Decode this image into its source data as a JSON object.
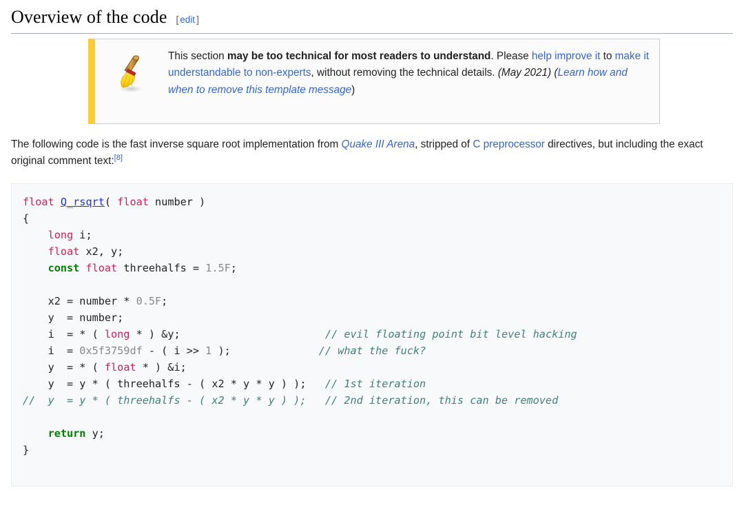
{
  "heading": {
    "title": "Overview of the code",
    "edit_open_bracket": "[",
    "edit_label": "edit",
    "edit_close_bracket": "]"
  },
  "notice": {
    "icon": "broom-icon",
    "accent_color": "#ffcc33",
    "border_color": "#c8ccd1",
    "background": "#fbfbfb",
    "text_parts": {
      "p1": "This section ",
      "bold1": "may be too technical for most readers to understand",
      "p2": ". Please ",
      "link1": "help improve it",
      "p3": " to ",
      "link2": "make it understandable to non-experts",
      "p4": ", without removing the technical details. ",
      "date": "(May 2021)",
      "p5": " (",
      "link3": "Learn how and when to remove this template message",
      "p6": ")"
    }
  },
  "intro": {
    "p1": "The following code is the fast inverse square root implementation from ",
    "link_quake": "Quake III Arena",
    "p2": ", stripped of ",
    "link_cpp": "C preprocessor",
    "p3": " directives, but including the exact original comment text:",
    "reference": "[8]"
  },
  "code": {
    "language": "C",
    "background": "#f8f9fa",
    "colors": {
      "type": "#cc2255",
      "keyword": "#008000",
      "function": "#2233cc",
      "number": "#888888",
      "comment": "#3f7f7f",
      "plain": "#222222"
    },
    "lines": [
      {
        "tokens": [
          {
            "t": "float",
            "c": "type"
          },
          {
            "t": " ",
            "c": "plain"
          },
          {
            "t": "Q_rsqrt",
            "c": "function"
          },
          {
            "t": "( ",
            "c": "plain"
          },
          {
            "t": "float",
            "c": "type"
          },
          {
            "t": " number )",
            "c": "plain"
          }
        ]
      },
      {
        "tokens": [
          {
            "t": "{",
            "c": "plain"
          }
        ]
      },
      {
        "tokens": [
          {
            "t": "    ",
            "c": "plain"
          },
          {
            "t": "long",
            "c": "type"
          },
          {
            "t": " i;",
            "c": "plain"
          }
        ]
      },
      {
        "tokens": [
          {
            "t": "    ",
            "c": "plain"
          },
          {
            "t": "float",
            "c": "type"
          },
          {
            "t": " x2, y;",
            "c": "plain"
          }
        ]
      },
      {
        "tokens": [
          {
            "t": "    ",
            "c": "plain"
          },
          {
            "t": "const",
            "c": "keyword"
          },
          {
            "t": " ",
            "c": "plain"
          },
          {
            "t": "float",
            "c": "type"
          },
          {
            "t": " threehalfs = ",
            "c": "plain"
          },
          {
            "t": "1.5F",
            "c": "number"
          },
          {
            "t": ";",
            "c": "plain"
          }
        ]
      },
      {
        "tokens": [
          {
            "t": "",
            "c": "plain"
          }
        ]
      },
      {
        "tokens": [
          {
            "t": "    x2 = number * ",
            "c": "plain"
          },
          {
            "t": "0.5F",
            "c": "number"
          },
          {
            "t": ";",
            "c": "plain"
          }
        ]
      },
      {
        "tokens": [
          {
            "t": "    y  = number;",
            "c": "plain"
          }
        ]
      },
      {
        "tokens": [
          {
            "t": "    i  = * ( ",
            "c": "plain"
          },
          {
            "t": "long",
            "c": "type"
          },
          {
            "t": " * ) &y;",
            "c": "plain"
          },
          {
            "t": "                       ",
            "c": "plain"
          },
          {
            "t": "// evil floating point bit level hacking",
            "c": "comment"
          }
        ]
      },
      {
        "tokens": [
          {
            "t": "    i  = ",
            "c": "plain"
          },
          {
            "t": "0x5f3759df",
            "c": "number"
          },
          {
            "t": " - ( i >> ",
            "c": "plain"
          },
          {
            "t": "1",
            "c": "number"
          },
          {
            "t": " );",
            "c": "plain"
          },
          {
            "t": "              ",
            "c": "plain"
          },
          {
            "t": "// what the fuck?",
            "c": "comment"
          }
        ]
      },
      {
        "tokens": [
          {
            "t": "    y  = * ( ",
            "c": "plain"
          },
          {
            "t": "float",
            "c": "type"
          },
          {
            "t": " * ) &i;",
            "c": "plain"
          }
        ]
      },
      {
        "tokens": [
          {
            "t": "    y  = y * ( threehalfs - ( x2 * y * y ) );",
            "c": "plain"
          },
          {
            "t": "   ",
            "c": "plain"
          },
          {
            "t": "// 1st iteration",
            "c": "comment"
          }
        ]
      },
      {
        "tokens": [
          {
            "t": "//  y  = y * ( threehalfs - ( x2 * y * y ) );   // 2nd iteration, this can be removed",
            "c": "comment"
          }
        ]
      },
      {
        "tokens": [
          {
            "t": "",
            "c": "plain"
          }
        ]
      },
      {
        "tokens": [
          {
            "t": "    ",
            "c": "plain"
          },
          {
            "t": "return",
            "c": "keyword"
          },
          {
            "t": " y;",
            "c": "plain"
          }
        ]
      },
      {
        "tokens": [
          {
            "t": "}",
            "c": "plain"
          }
        ]
      }
    ]
  }
}
